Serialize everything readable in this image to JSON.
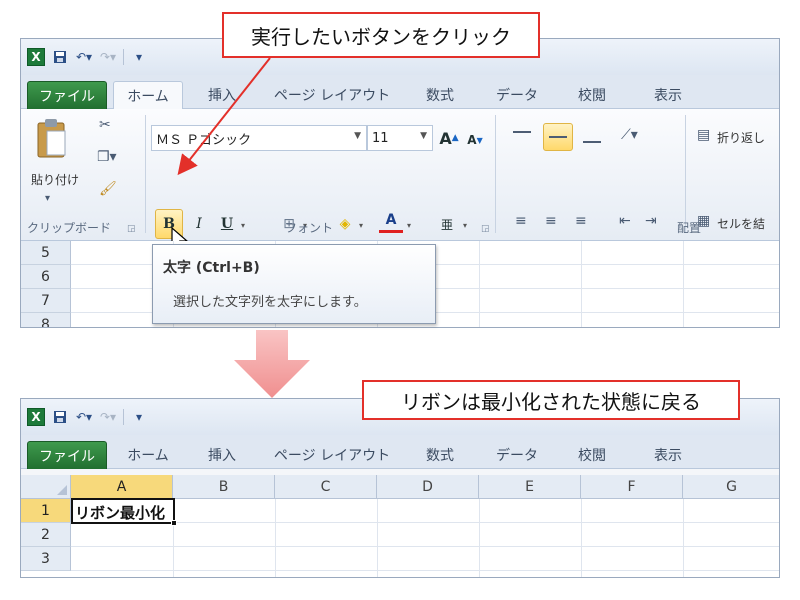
{
  "callouts": {
    "top": "実行したいボタンをクリック",
    "bottom": "リボンは最小化された状態に戻る"
  },
  "excel": {
    "logo": "X",
    "tabs": [
      "ファイル",
      "ホーム",
      "挿入",
      "ページ レイアウト",
      "数式",
      "データ",
      "校閲",
      "表示"
    ]
  },
  "ribbon": {
    "paste_label": "貼り付け",
    "clipboard_group": "クリップボード",
    "font_group": "フォント",
    "alignment_group": "配置",
    "font_name": "ＭＳ Ｐゴシック",
    "font_size": "11",
    "grow_font": "A",
    "shrink_font": "A",
    "bold": "B",
    "italic": "I",
    "underline": "U",
    "font_color_letter": "A",
    "wrap_text": "折り返し",
    "merge_cells": "セルを結"
  },
  "tooltip": {
    "title": "太字 (Ctrl+B)",
    "description": "選択した文字列を太字にします。"
  },
  "grid_top": {
    "rows": [
      "5",
      "6",
      "7",
      "8"
    ]
  },
  "grid_bottom": {
    "columns": [
      "A",
      "B",
      "C",
      "D",
      "E",
      "F",
      "G"
    ],
    "rows": [
      "1",
      "2",
      "3"
    ],
    "cell_a1": "リボン最小化"
  },
  "colors": {
    "callout_border": "#e3302a",
    "file_tab": "#2e8540",
    "highlight": "#ffd96b",
    "arrow_pink": "#f4a3a3"
  }
}
